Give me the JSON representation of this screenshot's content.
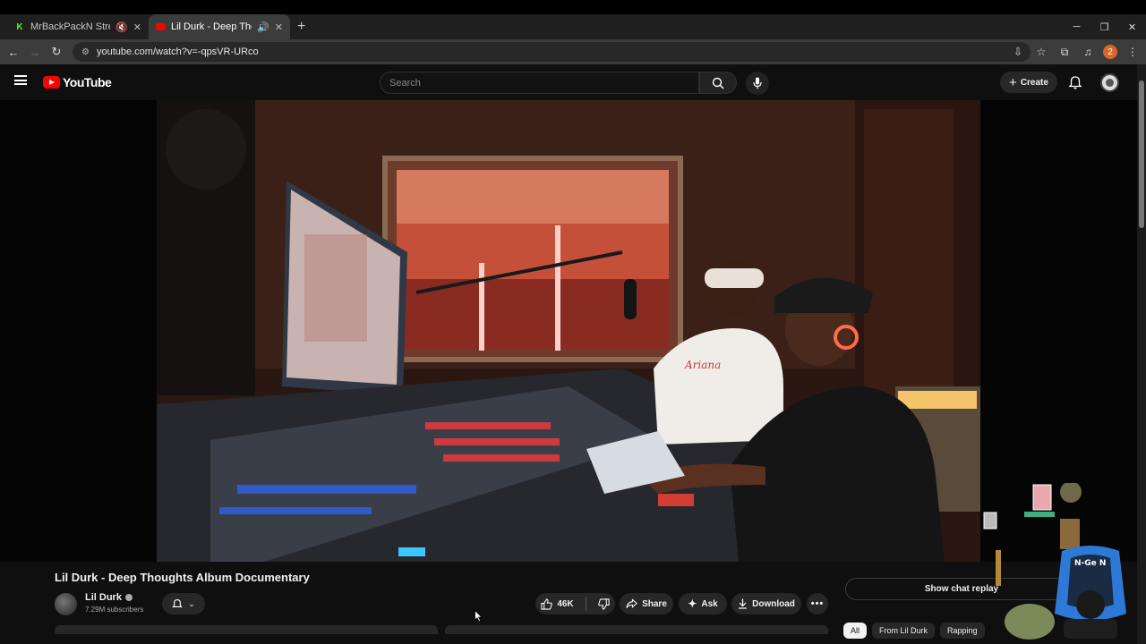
{
  "browser": {
    "tabs": [
      {
        "title": "MrBackPackN Stream - Wat",
        "favicon_letter": "K",
        "favicon_color": "#53fc18",
        "status": "muted"
      },
      {
        "title": "Lil Durk - Deep Thoughts Al",
        "favicon_color": "#ff0000",
        "status": "audio"
      }
    ],
    "url": "youtube.com/watch?v=-qpsVR-URco",
    "profile_initial": "2"
  },
  "youtube": {
    "brand": "YouTube",
    "search_placeholder": "Search",
    "create_label": "Create"
  },
  "video": {
    "title": "Lil Durk - Deep Thoughts Album Documentary",
    "channel": "Lil Durk",
    "subscribers": "7.29M subscribers",
    "likes": "46K",
    "share_label": "Share",
    "ask_label": "Ask",
    "download_label": "Download"
  },
  "sidebar": {
    "chat_replay_label": "Show chat replay",
    "chips": [
      "All",
      "From Lil Durk",
      "Rapping"
    ]
  },
  "overlay": {
    "chair_text": "N-Ge N"
  },
  "colors": {
    "accent": "#ff0000",
    "background": "#0f0f0f",
    "pill": "#272727"
  }
}
